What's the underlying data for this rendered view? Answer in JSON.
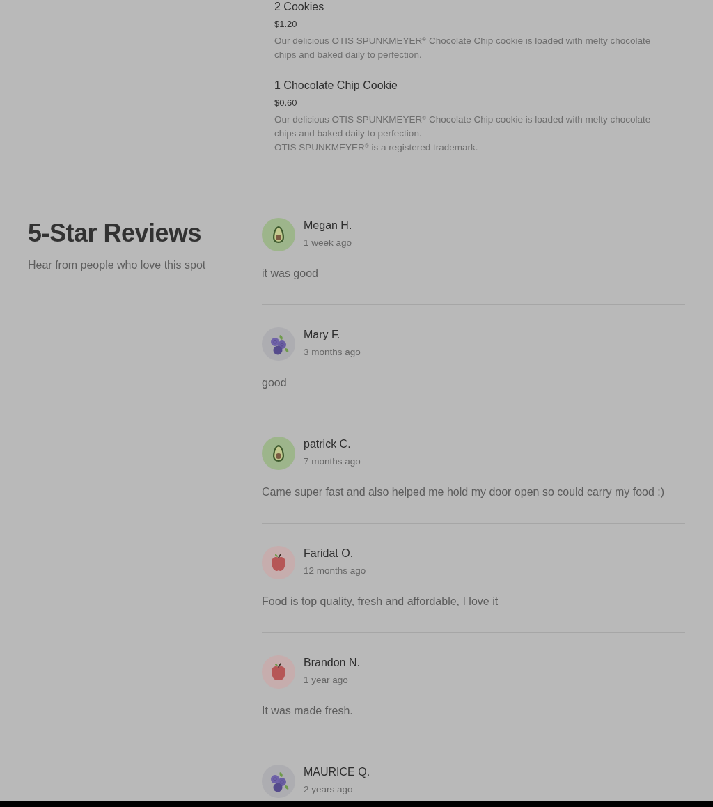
{
  "menu_items": [
    {
      "name": "2 Cookies",
      "price": "$1.20",
      "description": "Our delicious OTIS SPUNKMEYER$^{®}$ Chocolate Chip cookie is loaded with melty chocolate chips and baked daily to perfection."
    },
    {
      "name": "1 Chocolate Chip Cookie",
      "price": "$0.60",
      "description": "Our delicious OTIS SPUNKMEYER$^{®}$ Chocolate Chip cookie is loaded with melty chocolate chips and baked daily to perfection.",
      "note": "OTIS SPUNKMEYER$^{®}$ is a registered trademark."
    }
  ],
  "reviews_section": {
    "title": "5-Star Reviews",
    "subtitle": "Hear from people who love this spot"
  },
  "reviews": [
    {
      "kind": "avocado",
      "name": "Megan H.",
      "time": "1 week ago",
      "text": "it was good"
    },
    {
      "kind": "blueberry",
      "name": "Mary F.",
      "time": "3 months ago",
      "text": "good"
    },
    {
      "kind": "avocado",
      "name": "patrick C.",
      "time": "7 months ago",
      "text": "Came super fast and also helped me hold my door open so could carry my food :)"
    },
    {
      "kind": "apple",
      "name": "Faridat O.",
      "time": "12 months ago",
      "text": "Food is top quality, fresh and affordable, I love it"
    },
    {
      "kind": "apple",
      "name": "Brandon N.",
      "time": "1 year ago",
      "text": "It was made fresh."
    },
    {
      "kind": "blueberry",
      "name": "MAURICE Q.",
      "time": "2 years ago"
    }
  ]
}
